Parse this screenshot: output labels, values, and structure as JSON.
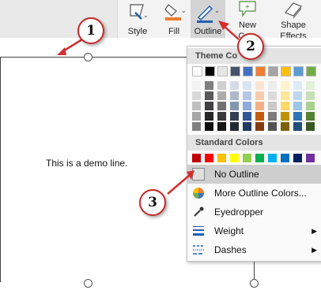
{
  "ribbon": {
    "style_label": "Style",
    "fill_label": "Fill",
    "outline_label": "Outline",
    "new_comment_label_1": "New",
    "new_comment_label_2": "Com",
    "shape_effects_label_1": "Shape",
    "shape_effects_label_2": "Effects"
  },
  "slide": {
    "text": "This is a demo line."
  },
  "menu": {
    "theme_colors_label": "Theme Co",
    "standard_colors_label": "Standard Colors",
    "items": [
      {
        "label": "No Outline",
        "icon": "no-outline-icon"
      },
      {
        "label": "More Outline Colors...",
        "icon": "color-wheel-icon"
      },
      {
        "label": "Eyedropper",
        "icon": "eyedropper-icon"
      },
      {
        "label": "Weight",
        "icon": "weight-icon"
      },
      {
        "label": "Dashes",
        "icon": "dashes-icon"
      }
    ],
    "theme_top_row": [
      "#ffffff",
      "#000000",
      "#e7e6e6",
      "#44546a",
      "#4472c4",
      "#ed7d31",
      "#a5a5a5",
      "#ffc000",
      "#5b9bd5",
      "#70ad47"
    ],
    "theme_shade_cols": [
      [
        "#f2f2f2",
        "#d9d9d9",
        "#bfbfbf",
        "#a6a6a6",
        "#808080"
      ],
      [
        "#7f7f7f",
        "#595959",
        "#404040",
        "#262626",
        "#0d0d0d"
      ],
      [
        "#d0cece",
        "#aeabab",
        "#757070",
        "#3a3838",
        "#171616"
      ],
      [
        "#d6dce5",
        "#adb9ca",
        "#8497b0",
        "#333f50",
        "#222a35"
      ],
      [
        "#dae3f3",
        "#b4c7e7",
        "#8faadc",
        "#2f5597",
        "#1f3864"
      ],
      [
        "#fbe5d6",
        "#f8cbad",
        "#f4b183",
        "#c55a11",
        "#843c0c"
      ],
      [
        "#ededed",
        "#dbdbdb",
        "#c9c9c9",
        "#7b7b7b",
        "#525252"
      ],
      [
        "#fff2cc",
        "#ffe699",
        "#ffd966",
        "#bf9000",
        "#7f6000"
      ],
      [
        "#deebf7",
        "#bdd7ee",
        "#9dc3e6",
        "#2e75b6",
        "#1f4e79"
      ],
      [
        "#e2f0d9",
        "#c5e0b4",
        "#a9d18e",
        "#548235",
        "#385723"
      ]
    ],
    "standard": [
      "#c00000",
      "#ff0000",
      "#ffc000",
      "#ffff00",
      "#92d050",
      "#00b050",
      "#00b0f0",
      "#0070c0",
      "#002060",
      "#7030a0"
    ]
  },
  "callouts": {
    "one": "1",
    "two": "2",
    "three": "3"
  },
  "colors": {
    "callout_border": "#c62828",
    "arrow": "#d32f2f"
  }
}
